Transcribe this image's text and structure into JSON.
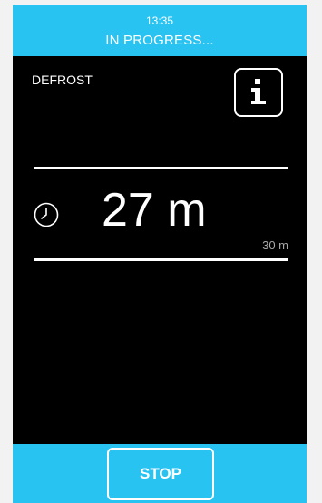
{
  "header": {
    "time": "13:35",
    "status": "IN PROGRESS..."
  },
  "program": {
    "name": "DEFROST"
  },
  "timer": {
    "remaining": "27 m",
    "total": "30 m"
  },
  "footer": {
    "stop_label": "STOP"
  },
  "colors": {
    "accent": "#29c3f2",
    "background": "#000000",
    "text": "#ffffff",
    "muted_text": "#a8a8a8"
  },
  "icons": [
    "info-icon",
    "clock-icon"
  ]
}
